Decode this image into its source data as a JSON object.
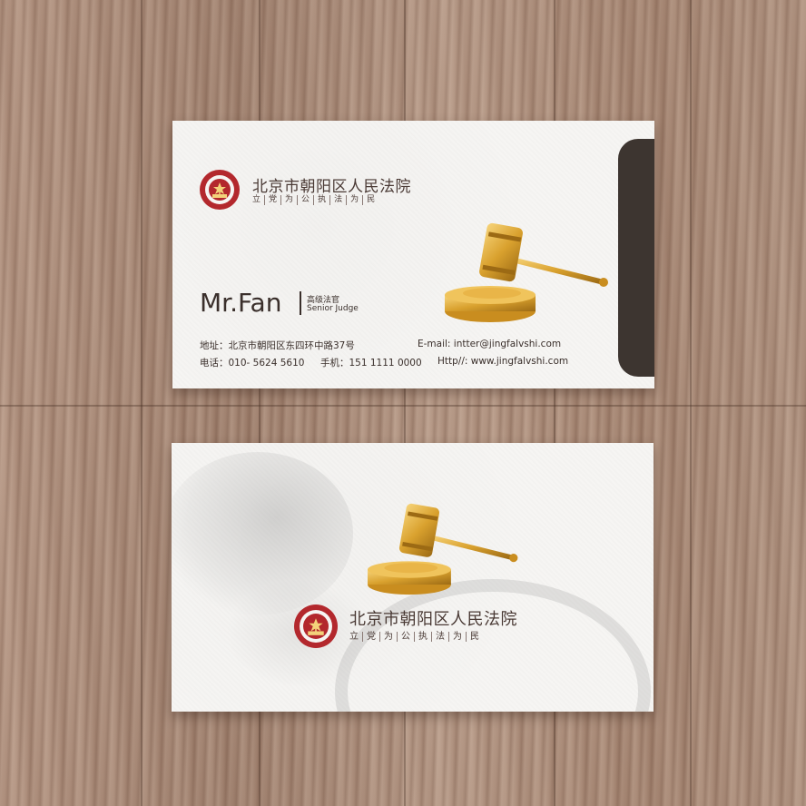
{
  "front": {
    "court_name": "北京市朝阳区人民法院",
    "motto": [
      "立",
      "党",
      "为",
      "公",
      "执",
      "法",
      "为",
      "民"
    ],
    "person_name": "Mr.Fan",
    "title_cn": "高级法官",
    "title_en": "Senior Judge",
    "address": "地址：北京市朝阳区东四环中路37号",
    "email": "E-mail:  intter@jingfalvshi.com",
    "phone": "电话：010- 5624 5610",
    "mobile": "手机：151 1111 0000",
    "website": "Http//:  www.jingfalvshi.com"
  },
  "back": {
    "court_name": "北京市朝阳区人民法院",
    "motto": [
      "立",
      "党",
      "为",
      "公",
      "执",
      "法",
      "为",
      "民"
    ]
  },
  "colors": {
    "emblem_red": "#b3282d",
    "tab_dark": "#3d3530",
    "gavel_gold": "#d9a12e"
  }
}
